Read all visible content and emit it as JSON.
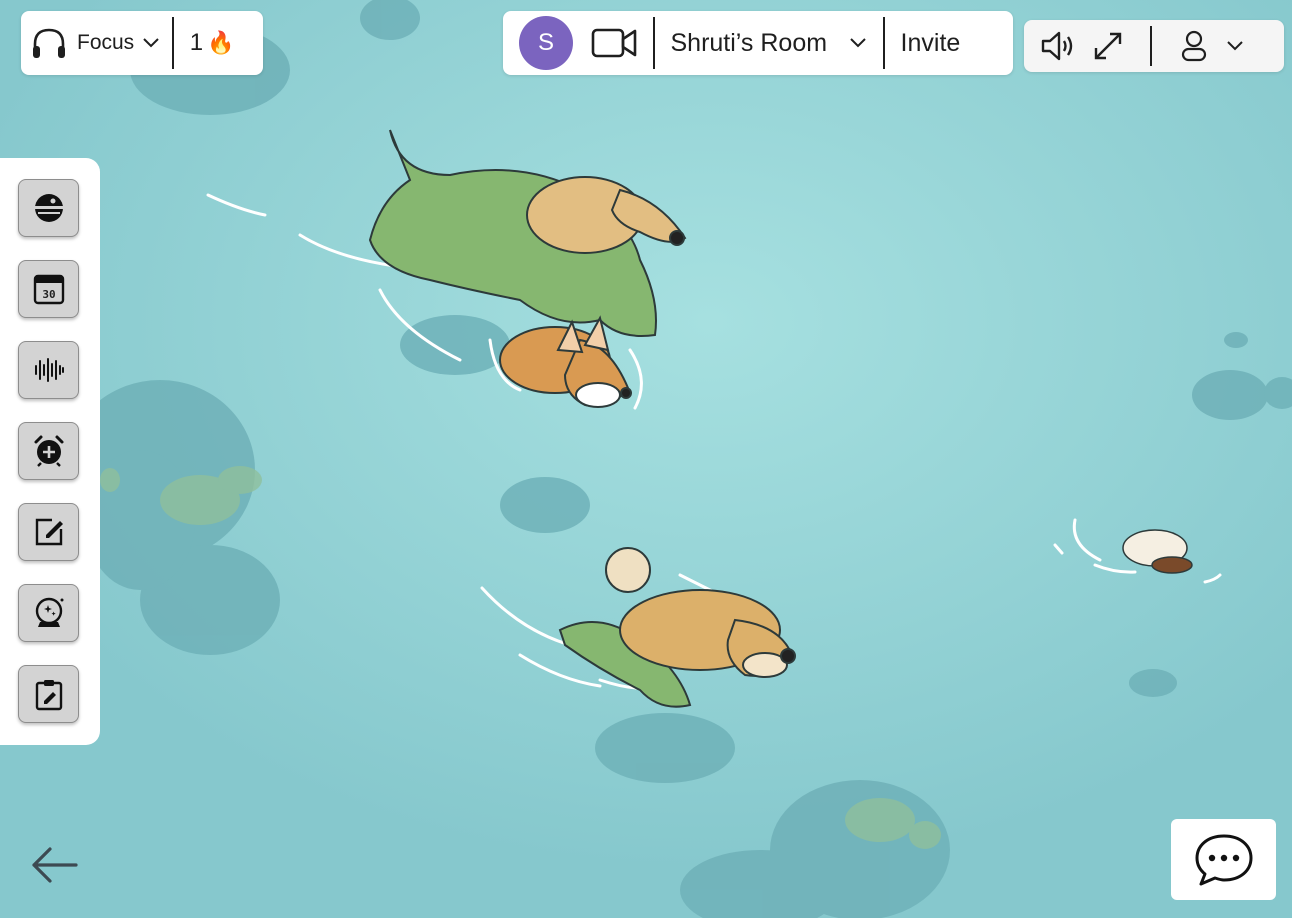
{
  "focus": {
    "label": "Focus",
    "streak_count": "1",
    "streak_icon": "🔥"
  },
  "room": {
    "avatar_initial": "S",
    "avatar_color": "#7b64bf",
    "name": "Shruti’s Room",
    "invite_label": "Invite"
  },
  "toolbar": {
    "tools": [
      {
        "icon": "scene-globe-icon"
      },
      {
        "icon": "calendar-icon",
        "text": "30"
      },
      {
        "icon": "sound-wave-icon"
      },
      {
        "icon": "alarm-add-icon"
      },
      {
        "icon": "notes-edit-icon"
      },
      {
        "icon": "crystal-ball-icon"
      },
      {
        "icon": "clipboard-edit-icon"
      }
    ]
  },
  "colors": {
    "water": "#8fcfd2",
    "panel": "#ffffff",
    "tool_bg": "#d3d3d3"
  }
}
